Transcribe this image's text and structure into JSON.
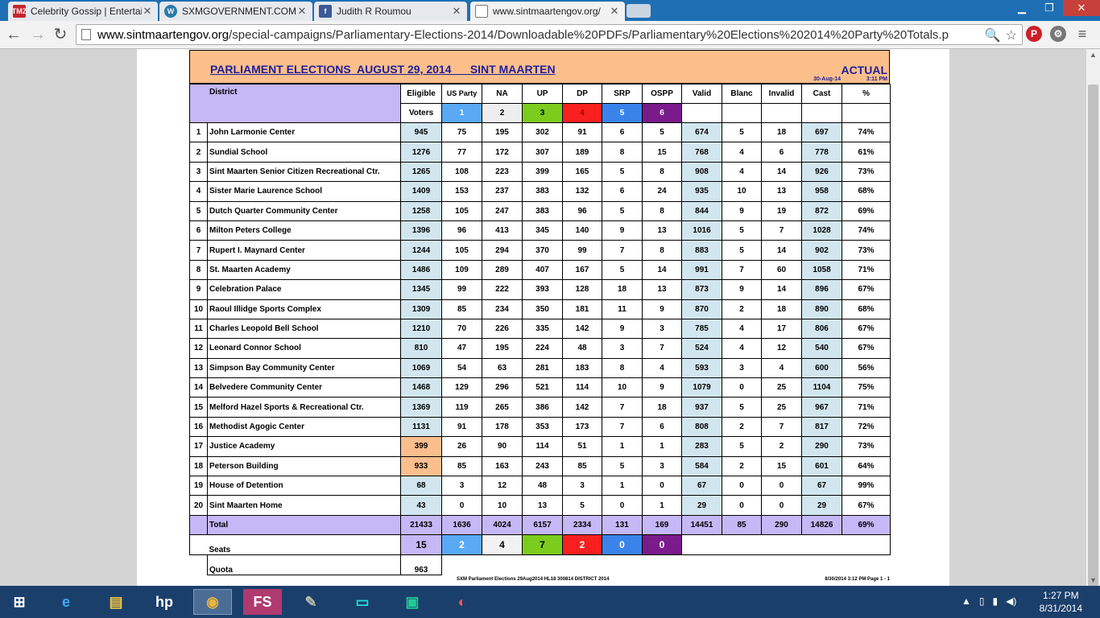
{
  "browser": {
    "tabs": [
      {
        "title": "Celebrity Gossip | Entertai",
        "icon": "tmz-icon",
        "fav_text": "TMZ",
        "fav_color": "#c4262e"
      },
      {
        "title": "SXMGOVERNMENT.COM",
        "icon": "wordpress-icon",
        "fav_text": "W",
        "fav_color": "#2a7aa9"
      },
      {
        "title": "Judith R Roumou",
        "icon": "facebook-icon",
        "fav_text": "f",
        "fav_color": "#3b5998"
      },
      {
        "title": "www.sintmaartengov.org/",
        "icon": "page-icon",
        "fav_text": "",
        "fav_color": "#ffffff"
      }
    ],
    "url_host": "www.sintmaartengov.org",
    "url_path": "/special-campaigns/Parliamentary-Elections-2014/Downloadable%20PDFs/Parliamentary%20Elections%202014%20Party%20Totals.p"
  },
  "report": {
    "title": "PARLIAMENT ELECTIONS  AUGUST 29, 2014      SINT MAARTEN",
    "status": "ACTUAL",
    "date": "30-Aug-14",
    "time": "3:11 PM",
    "headers": {
      "district": "District",
      "eligible": "Eligible",
      "voters": "Voters",
      "valid": "Valid",
      "blanc": "Blanc",
      "invalid": "Invalid",
      "cast": "Cast",
      "pct": "%"
    },
    "parties": [
      {
        "name": "US Party",
        "number": "1"
      },
      {
        "name": "NA",
        "number": "2"
      },
      {
        "name": "UP",
        "number": "3"
      },
      {
        "name": "DP",
        "number": "4"
      },
      {
        "name": "SRP",
        "number": "5"
      },
      {
        "name": "OSPP",
        "number": "6"
      }
    ],
    "rows": [
      {
        "no": "1",
        "district": "John Larmonie Center",
        "eligible": "945",
        "us": "75",
        "na": "195",
        "up": "302",
        "dp": "91",
        "srp": "6",
        "ospp": "5",
        "valid": "674",
        "blanc": "5",
        "invalid": "18",
        "cast": "697",
        "pct": "74%"
      },
      {
        "no": "2",
        "district": "Sundial School",
        "eligible": "1276",
        "us": "77",
        "na": "172",
        "up": "307",
        "dp": "189",
        "srp": "8",
        "ospp": "15",
        "valid": "768",
        "blanc": "4",
        "invalid": "6",
        "cast": "778",
        "pct": "61%"
      },
      {
        "no": "3",
        "district": "Sint Maarten Senior Citizen Recreational Ctr.",
        "eligible": "1265",
        "us": "108",
        "na": "223",
        "up": "399",
        "dp": "165",
        "srp": "5",
        "ospp": "8",
        "valid": "908",
        "blanc": "4",
        "invalid": "14",
        "cast": "926",
        "pct": "73%"
      },
      {
        "no": "4",
        "district": "Sister Marie Laurence School",
        "eligible": "1409",
        "us": "153",
        "na": "237",
        "up": "383",
        "dp": "132",
        "srp": "6",
        "ospp": "24",
        "valid": "935",
        "blanc": "10",
        "invalid": "13",
        "cast": "958",
        "pct": "68%"
      },
      {
        "no": "5",
        "district": "Dutch Quarter Community Center",
        "eligible": "1258",
        "us": "105",
        "na": "247",
        "up": "383",
        "dp": "96",
        "srp": "5",
        "ospp": "8",
        "valid": "844",
        "blanc": "9",
        "invalid": "19",
        "cast": "872",
        "pct": "69%"
      },
      {
        "no": "6",
        "district": "Milton Peters College",
        "eligible": "1396",
        "us": "96",
        "na": "413",
        "up": "345",
        "dp": "140",
        "srp": "9",
        "ospp": "13",
        "valid": "1016",
        "blanc": "5",
        "invalid": "7",
        "cast": "1028",
        "pct": "74%"
      },
      {
        "no": "7",
        "district": "Rupert I. Maynard Center",
        "eligible": "1244",
        "us": "105",
        "na": "294",
        "up": "370",
        "dp": "99",
        "srp": "7",
        "ospp": "8",
        "valid": "883",
        "blanc": "5",
        "invalid": "14",
        "cast": "902",
        "pct": "73%"
      },
      {
        "no": "8",
        "district": "St. Maarten Academy",
        "eligible": "1486",
        "us": "109",
        "na": "289",
        "up": "407",
        "dp": "167",
        "srp": "5",
        "ospp": "14",
        "valid": "991",
        "blanc": "7",
        "invalid": "60",
        "cast": "1058",
        "pct": "71%"
      },
      {
        "no": "9",
        "district": "Celebration Palace",
        "eligible": "1345",
        "us": "99",
        "na": "222",
        "up": "393",
        "dp": "128",
        "srp": "18",
        "ospp": "13",
        "valid": "873",
        "blanc": "9",
        "invalid": "14",
        "cast": "896",
        "pct": "67%"
      },
      {
        "no": "10",
        "district": "Raoul Illidge Sports Complex",
        "eligible": "1309",
        "us": "85",
        "na": "234",
        "up": "350",
        "dp": "181",
        "srp": "11",
        "ospp": "9",
        "valid": "870",
        "blanc": "2",
        "invalid": "18",
        "cast": "890",
        "pct": "68%"
      },
      {
        "no": "11",
        "district": "Charles Leopold Bell School",
        "eligible": "1210",
        "us": "70",
        "na": "226",
        "up": "335",
        "dp": "142",
        "srp": "9",
        "ospp": "3",
        "valid": "785",
        "blanc": "4",
        "invalid": "17",
        "cast": "806",
        "pct": "67%"
      },
      {
        "no": "12",
        "district": "Leonard Connor School",
        "eligible": "810",
        "us": "47",
        "na": "195",
        "up": "224",
        "dp": "48",
        "srp": "3",
        "ospp": "7",
        "valid": "524",
        "blanc": "4",
        "invalid": "12",
        "cast": "540",
        "pct": "67%"
      },
      {
        "no": "13",
        "district": "Simpson Bay Community Center",
        "eligible": "1069",
        "us": "54",
        "na": "63",
        "up": "281",
        "dp": "183",
        "srp": "8",
        "ospp": "4",
        "valid": "593",
        "blanc": "3",
        "invalid": "4",
        "cast": "600",
        "pct": "56%"
      },
      {
        "no": "14",
        "district": "Belvedere Community Center",
        "eligible": "1468",
        "us": "129",
        "na": "296",
        "up": "521",
        "dp": "114",
        "srp": "10",
        "ospp": "9",
        "valid": "1079",
        "blanc": "0",
        "invalid": "25",
        "cast": "1104",
        "pct": "75%"
      },
      {
        "no": "15",
        "district": "Melford Hazel Sports & Recreational Ctr.",
        "eligible": "1369",
        "us": "119",
        "na": "265",
        "up": "386",
        "dp": "142",
        "srp": "7",
        "ospp": "18",
        "valid": "937",
        "blanc": "5",
        "invalid": "25",
        "cast": "967",
        "pct": "71%"
      },
      {
        "no": "16",
        "district": "Methodist Agogic Center",
        "eligible": "1131",
        "us": "91",
        "na": "178",
        "up": "353",
        "dp": "173",
        "srp": "7",
        "ospp": "6",
        "valid": "808",
        "blanc": "2",
        "invalid": "7",
        "cast": "817",
        "pct": "72%"
      },
      {
        "no": "17",
        "district": "Justice Academy",
        "eligible": "399",
        "us": "26",
        "na": "90",
        "up": "114",
        "dp": "51",
        "srp": "1",
        "ospp": "1",
        "valid": "283",
        "blanc": "5",
        "invalid": "2",
        "cast": "290",
        "pct": "73%",
        "highlight": true
      },
      {
        "no": "18",
        "district": "Peterson Building",
        "eligible": "933",
        "us": "85",
        "na": "163",
        "up": "243",
        "dp": "85",
        "srp": "5",
        "ospp": "3",
        "valid": "584",
        "blanc": "2",
        "invalid": "15",
        "cast": "601",
        "pct": "64%",
        "highlight": true
      },
      {
        "no": "19",
        "district": "House of Detention",
        "eligible": "68",
        "us": "3",
        "na": "12",
        "up": "48",
        "dp": "3",
        "srp": "1",
        "ospp": "0",
        "valid": "67",
        "blanc": "0",
        "invalid": "0",
        "cast": "67",
        "pct": "99%"
      },
      {
        "no": "20",
        "district": "Sint Maarten Home",
        "eligible": "43",
        "us": "0",
        "na": "10",
        "up": "13",
        "dp": "5",
        "srp": "0",
        "ospp": "1",
        "valid": "29",
        "blanc": "0",
        "invalid": "0",
        "cast": "29",
        "pct": "67%"
      }
    ],
    "total": {
      "label": "Total",
      "eligible": "21433",
      "us": "1636",
      "na": "4024",
      "up": "6157",
      "dp": "2334",
      "srp": "131",
      "ospp": "169",
      "valid": "14451",
      "blanc": "85",
      "invalid": "290",
      "cast": "14826",
      "pct": "69%"
    },
    "seats": {
      "label": "Seats",
      "total": "15",
      "us": "2",
      "na": "4",
      "up": "7",
      "dp": "2",
      "srp": "0",
      "ospp": "0"
    },
    "quota": {
      "label": "Quota",
      "value": "963"
    },
    "footer_left": "SXM Parliament Elections  29Aug2014  HL18  300814  DISTRICT 2014",
    "footer_right": "8/30/2014  3:12 PM  Page 1 - 1"
  },
  "taskbar": {
    "apps": [
      "start-icon",
      "internet-explorer-icon",
      "file-explorer-icon",
      "hp-icon",
      "chrome-icon",
      "fs-icon",
      "gimp-icon",
      "screen-icon",
      "jpg-icon",
      "app-icon"
    ],
    "time": "1:27 PM",
    "date": "8/31/2014"
  },
  "colors": {
    "header_band": "#fcbf8c",
    "lilac": "#c4b8f6",
    "voters_col": "#d2e6ef",
    "highlight": "#fbbf8e",
    "party_us": "#5aa9f5",
    "party_up": "#7ccc1e",
    "party_dp": "#f81f1f",
    "party_srp": "#3a83eb",
    "party_ospp": "#7b1a8c"
  }
}
